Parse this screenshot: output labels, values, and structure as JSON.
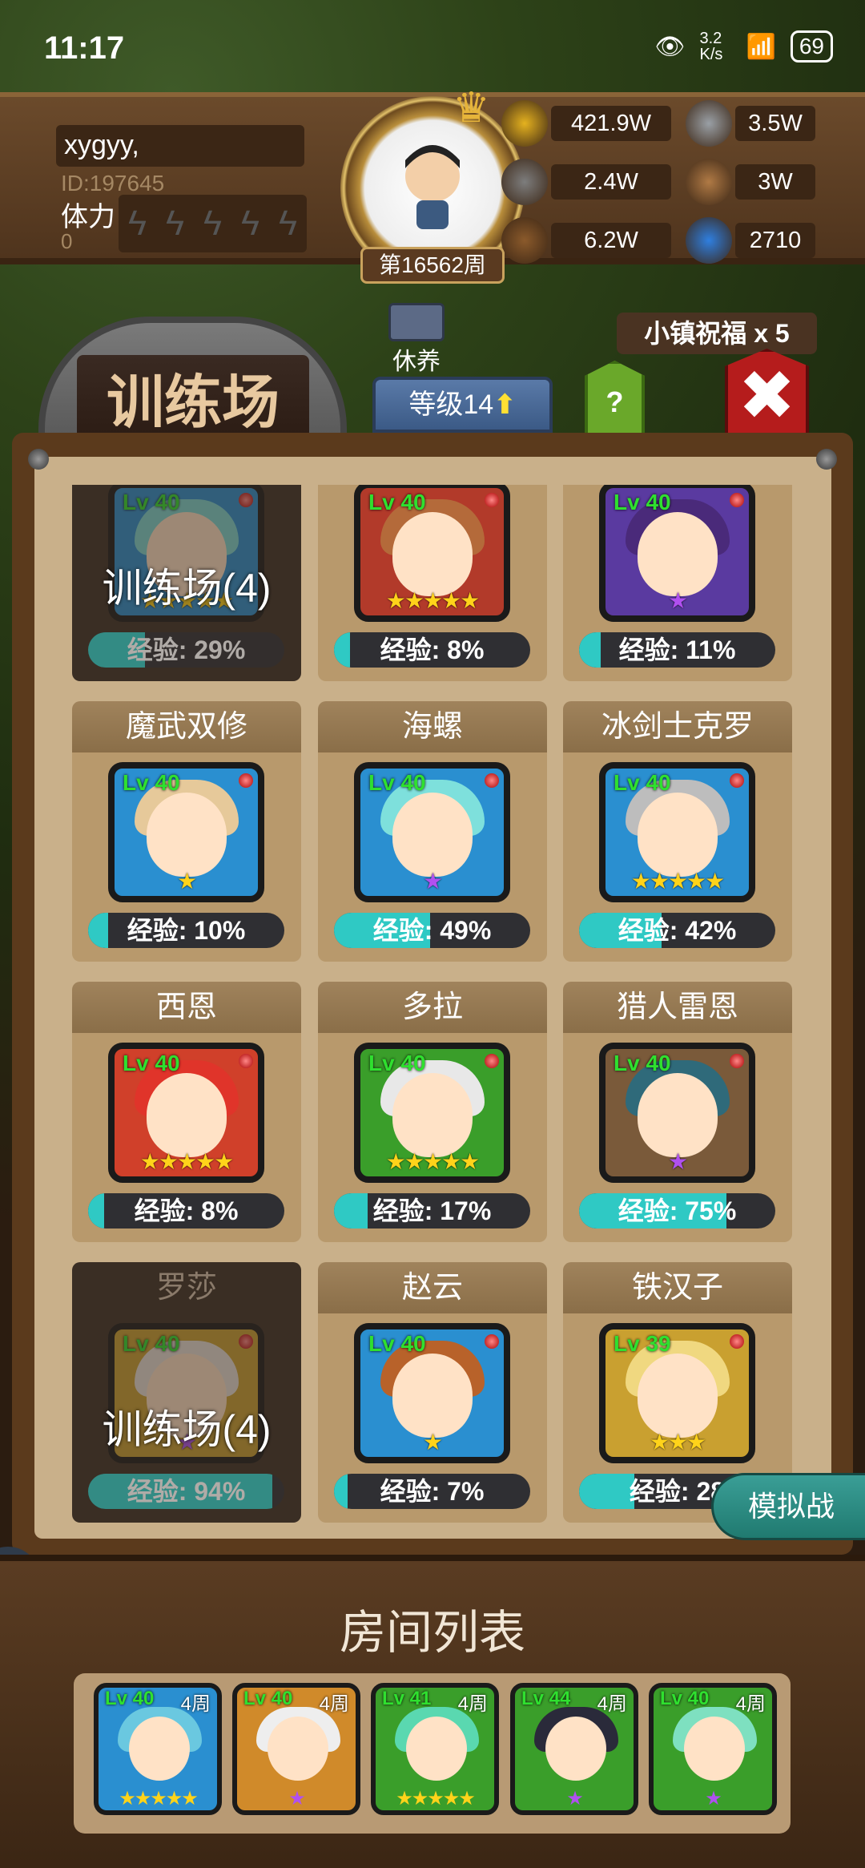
{
  "status": {
    "time": "11:17",
    "net_speed": "3.2 K/s",
    "battery": "69"
  },
  "player": {
    "name": "xygyy,",
    "id": "ID:197645",
    "stamina_label": "体力",
    "stamina_value": "0",
    "week": "第16562周"
  },
  "resources": [
    {
      "name": "gold-coin-icon",
      "value": "421.9W",
      "color": "#e5b21f"
    },
    {
      "name": "iron-ingot-icon",
      "value": "3.5W",
      "color": "#9aa0a6"
    },
    {
      "name": "stone-icon",
      "value": "2.4W",
      "color": "#7d7d7d"
    },
    {
      "name": "leather-icon",
      "value": "3W",
      "color": "#b07a45"
    },
    {
      "name": "wood-log-icon",
      "value": "6.2W",
      "color": "#8b5a2b"
    },
    {
      "name": "crystal-icon",
      "value": "2710",
      "color": "#2f7fe0"
    }
  ],
  "nav": {
    "title": "训练场",
    "rest_label": "休养",
    "level_tab": "等级14",
    "level_up_arrow": "⬆",
    "blessing": "小镇祝福 x 5",
    "help": "?",
    "close": "✖"
  },
  "heroes": [
    {
      "name": "",
      "level": "Lv 40",
      "exp": "经验: 29%",
      "exp_pct": 29,
      "stars": "★★★★★",
      "star_color": "gold",
      "frame": "#2a8fd0",
      "hair": "#7ad6d2",
      "training": true,
      "overlay": "训练场(4)"
    },
    {
      "name": "",
      "level": "Lv 40",
      "exp": "经验: 8%",
      "exp_pct": 8,
      "stars": "★★★★★",
      "star_color": "gold",
      "frame": "#b23a2a",
      "hair": "#b46a3a",
      "training": false,
      "overlay": ""
    },
    {
      "name": "",
      "level": "Lv 40",
      "exp": "经验: 11%",
      "exp_pct": 11,
      "stars": "★",
      "star_color": "purple",
      "frame": "#5a3aa0",
      "hair": "#4a2a7a",
      "training": false,
      "overlay": ""
    },
    {
      "name": "魔武双修",
      "level": "Lv 40",
      "exp": "经验: 10%",
      "exp_pct": 10,
      "stars": "★",
      "star_color": "gold",
      "frame": "#2a8fd0",
      "hair": "#e6c99a",
      "training": false,
      "overlay": ""
    },
    {
      "name": "海螺",
      "level": "Lv 40",
      "exp": "经验: 49%",
      "exp_pct": 49,
      "stars": "★",
      "star_color": "purple",
      "frame": "#2a8fd0",
      "hair": "#7ee0dc",
      "training": false,
      "overlay": ""
    },
    {
      "name": "冰剑士克罗",
      "level": "Lv 40",
      "exp": "经验: 42%",
      "exp_pct": 42,
      "stars": "★★★★★",
      "star_color": "gold",
      "frame": "#2a8fd0",
      "hair": "#bdbdbd",
      "training": false,
      "overlay": ""
    },
    {
      "name": "西恩",
      "level": "Lv 40",
      "exp": "经验: 8%",
      "exp_pct": 8,
      "stars": "★★★★★",
      "star_color": "gold",
      "frame": "#d0402a",
      "hair": "#e0342a",
      "training": false,
      "overlay": ""
    },
    {
      "name": "多拉",
      "level": "Lv 40",
      "exp": "经验: 17%",
      "exp_pct": 17,
      "stars": "★★★★★",
      "star_color": "gold",
      "frame": "#3a9e2a",
      "hair": "#e8e8e8",
      "training": false,
      "overlay": ""
    },
    {
      "name": "猎人雷恩",
      "level": "Lv 40",
      "exp": "经验: 75%",
      "exp_pct": 75,
      "stars": "★",
      "star_color": "purple",
      "frame": "#7a5a3a",
      "hair": "#2f6a7a",
      "training": false,
      "overlay": ""
    },
    {
      "name": "罗莎",
      "level": "Lv 40",
      "exp": "经验: 94%",
      "exp_pct": 94,
      "stars": "★",
      "star_color": "purple",
      "frame": "#c9a030",
      "hair": "#e8e0d8",
      "training": true,
      "overlay": "训练场(4)"
    },
    {
      "name": "赵云",
      "level": "Lv 40",
      "exp": "经验: 7%",
      "exp_pct": 7,
      "stars": "★",
      "star_color": "gold",
      "frame": "#2a8fd0",
      "hair": "#b8622a",
      "training": false,
      "overlay": ""
    },
    {
      "name": "铁汉子",
      "level": "Lv 39",
      "exp": "经验: 28",
      "exp_pct": 28,
      "stars": "★★★",
      "star_color": "gold",
      "frame": "#c9a030",
      "hair": "#f0d880",
      "training": false,
      "overlay": ""
    }
  ],
  "sim_button": "模拟战",
  "room_title": "房间列表",
  "rooms": [
    {
      "level": "Lv 40",
      "weeks": "4周",
      "stars": "★★★★★",
      "star_color": "gold",
      "frame": "#2a8fd0",
      "hair": "#6ac8e0"
    },
    {
      "level": "Lv 40",
      "weeks": "4周",
      "stars": "★",
      "star_color": "purple",
      "frame": "#d08a2a",
      "hair": "#eeeeee"
    },
    {
      "level": "Lv 41",
      "weeks": "4周",
      "stars": "★★★★★",
      "star_color": "gold",
      "frame": "#3a9e2a",
      "hair": "#5ad8b0"
    },
    {
      "level": "Lv 44",
      "weeks": "4周",
      "stars": "★",
      "star_color": "purple",
      "frame": "#3a9e2a",
      "hair": "#2a2a3a"
    },
    {
      "level": "Lv 40",
      "weeks": "4周",
      "stars": "★",
      "star_color": "purple",
      "frame": "#3a9e2a",
      "hair": "#7ee0c0"
    }
  ]
}
